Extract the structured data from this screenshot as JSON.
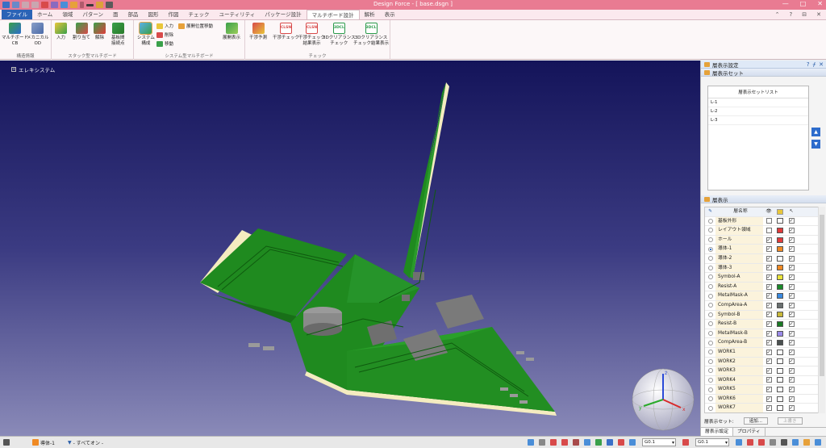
{
  "app": {
    "title": "Design Force - [ base.dsgn ]"
  },
  "window": {
    "minimize": "—",
    "maximize": "□",
    "close": "✕"
  },
  "tabs": [
    "ファイル",
    "ホーム",
    "領域",
    "パターン",
    "面",
    "部品",
    "図形",
    "作図",
    "チェック",
    "ユーティリティ",
    "パッケージ設計",
    "マルチボード設計",
    "解析",
    "表示"
  ],
  "active_tab": "マルチボード設計",
  "tab_right": {
    "up": "⌃",
    "help": "?",
    "pin": "⊟",
    "close": "✕"
  },
  "ribbon": {
    "groups": {
      "config": "構造情報",
      "stack": "スタック型マルチボード",
      "system": "システム型マルチボード",
      "check": "チェック"
    },
    "buttons": {
      "multiboard_cb": "マルチボード\nCB",
      "mechanical_od": "メカニカル\nOD",
      "input": "入力",
      "assign": "割り当て",
      "release": "解除",
      "board_connect": "基板間\n接続点",
      "system_config": "システム\n構成",
      "sys_input": "入力",
      "sys_delete": "削除",
      "sys_move": "移動",
      "expand_move": "展開位置移動",
      "expand_display": "展開表示",
      "interference_predict": "干渉予測",
      "interference_check": "干渉チェック",
      "interference_result": "干渉チェック\n結果表示",
      "clearance_check": "3Dクリアランス\nチェック",
      "clearance_result": "3Dクリアランス\nチェック結果表示"
    },
    "icon_labels": {
      "clsn": "CLSN",
      "dcl": "3DCL"
    }
  },
  "viewport": {
    "tree_root": "エレキシステム",
    "tree_toggle": "+",
    "gizmo_axes": {
      "x": "x",
      "y": "y",
      "z": "z"
    }
  },
  "panel": {
    "title": "層表示設定",
    "title_buttons": {
      "help": "?",
      "pin": "ᚋ",
      "close": "✕"
    },
    "set_section": "層表示セット",
    "set_list_header": "層表示セットリスト",
    "sets": [
      "L-1",
      "L-2",
      "L-3"
    ],
    "move_up": "▲",
    "move_down": "▼",
    "layer_section": "層表示",
    "layer_name_header": "層名称",
    "header_eye": "👁",
    "header_select": "↖",
    "layers": [
      {
        "name": "基板外形",
        "selected": false,
        "visible": false,
        "color": "#ffffff",
        "select": true
      },
      {
        "name": "レイアウト領域",
        "selected": false,
        "visible": false,
        "color": "#e23b3b",
        "select": true
      },
      {
        "name": "ホール",
        "selected": false,
        "visible": true,
        "color": "#e23b3b",
        "select": true
      },
      {
        "name": "導体-1",
        "selected": true,
        "visible": true,
        "color": "#f08a24",
        "select": true
      },
      {
        "name": "導体-2",
        "selected": false,
        "visible": true,
        "color": "#ffffff",
        "select": true
      },
      {
        "name": "導体-3",
        "selected": false,
        "visible": true,
        "color": "#f08a24",
        "select": true
      },
      {
        "name": "Symbol-A",
        "selected": false,
        "visible": true,
        "color": "#e8e23a",
        "select": true
      },
      {
        "name": "Resist-A",
        "selected": false,
        "visible": true,
        "color": "#1a8a2a",
        "select": true
      },
      {
        "name": "MetalMask-A",
        "selected": false,
        "visible": true,
        "color": "#3a8ae0",
        "select": true
      },
      {
        "name": "CompArea-A",
        "selected": false,
        "visible": true,
        "color": "#6a7070",
        "select": true
      },
      {
        "name": "Symbol-B",
        "selected": false,
        "visible": true,
        "color": "#c8b83a",
        "select": true
      },
      {
        "name": "Resist-B",
        "selected": false,
        "visible": true,
        "color": "#1a7a24",
        "select": true
      },
      {
        "name": "MetalMask-B",
        "selected": false,
        "visible": true,
        "color": "#9a8ae8",
        "select": true
      },
      {
        "name": "CompArea-B",
        "selected": false,
        "visible": true,
        "color": "#4a5050",
        "select": true
      },
      {
        "name": "WORK1",
        "selected": false,
        "visible": true,
        "color": "#ffffff",
        "select": true
      },
      {
        "name": "WORK2",
        "selected": false,
        "visible": true,
        "color": "#ffffff",
        "select": true
      },
      {
        "name": "WORK3",
        "selected": false,
        "visible": true,
        "color": "#ffffff",
        "select": true
      },
      {
        "name": "WORK4",
        "selected": false,
        "visible": true,
        "color": "#ffffff",
        "select": true
      },
      {
        "name": "WORK5",
        "selected": false,
        "visible": true,
        "color": "#ffffff",
        "select": true
      },
      {
        "name": "WORK6",
        "selected": false,
        "visible": true,
        "color": "#ffffff",
        "select": true
      },
      {
        "name": "WORK7",
        "selected": false,
        "visible": true,
        "color": "#ffffff",
        "select": true
      }
    ],
    "footer_label": "層表示セット:",
    "add_button": "追加...",
    "overwrite_button": "上書き",
    "bottom_tabs": [
      "層表示設定",
      "プロパティ"
    ]
  },
  "statusbar": {
    "layer": "導体-1",
    "filter": "- すべてオン -",
    "grid1": "G0.1",
    "grid2": "G0.1"
  },
  "colors": {
    "titlebar": "#e97b92",
    "board": "#1f8a1f",
    "edge": "#f4ecc0"
  }
}
